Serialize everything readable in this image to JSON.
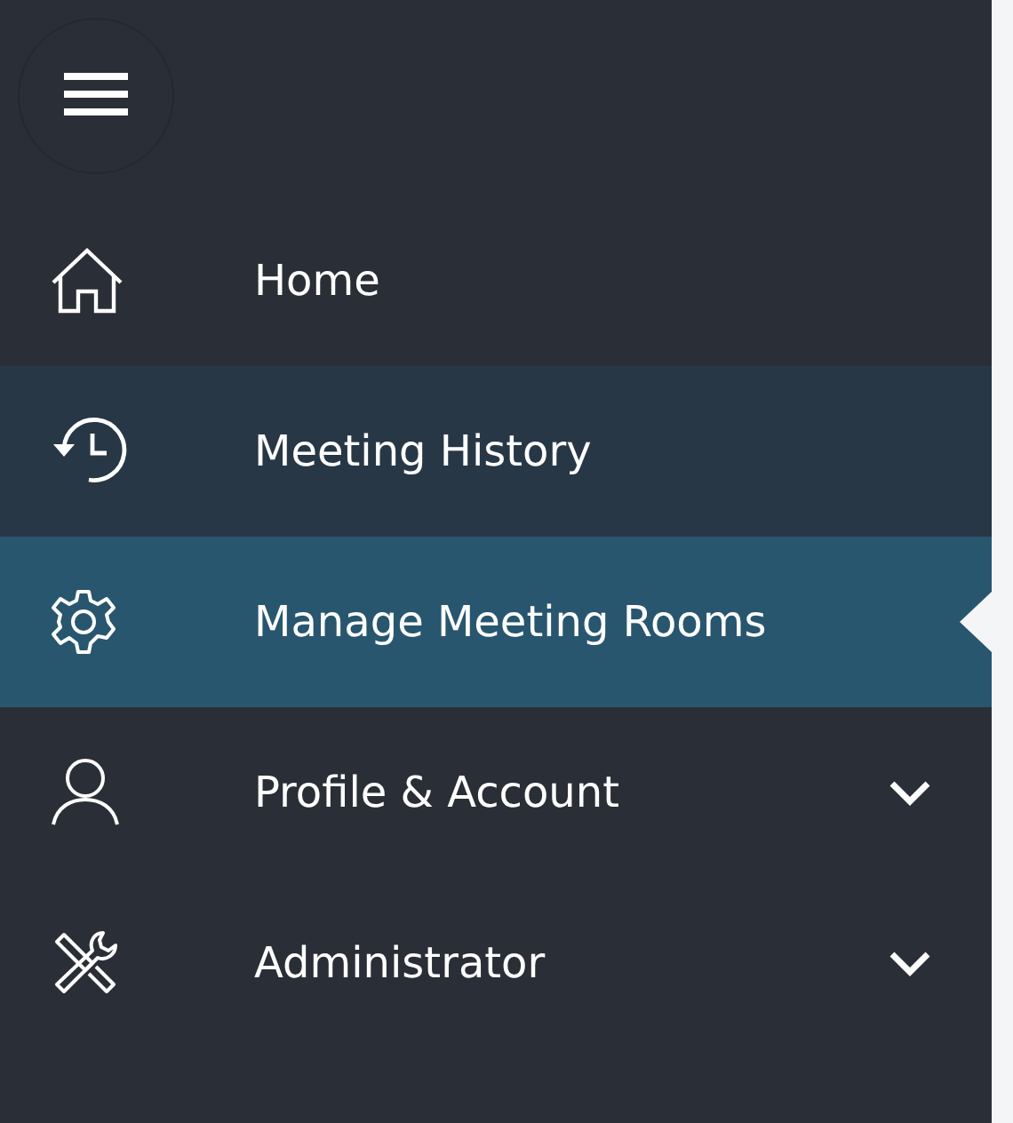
{
  "nav_items": [
    {
      "label": "Home",
      "kind": "home",
      "selected": false,
      "highlighted": false,
      "expandable": false
    },
    {
      "label": "Meeting History",
      "kind": "history",
      "selected": false,
      "highlighted": true,
      "expandable": false
    },
    {
      "label": "Manage Meeting Rooms",
      "kind": "gear",
      "selected": true,
      "highlighted": false,
      "expandable": false
    },
    {
      "label": "Profile & Account",
      "kind": "person",
      "selected": false,
      "highlighted": false,
      "expandable": true
    },
    {
      "label": "Administrator",
      "kind": "tools",
      "selected": false,
      "highlighted": false,
      "expandable": true
    }
  ]
}
